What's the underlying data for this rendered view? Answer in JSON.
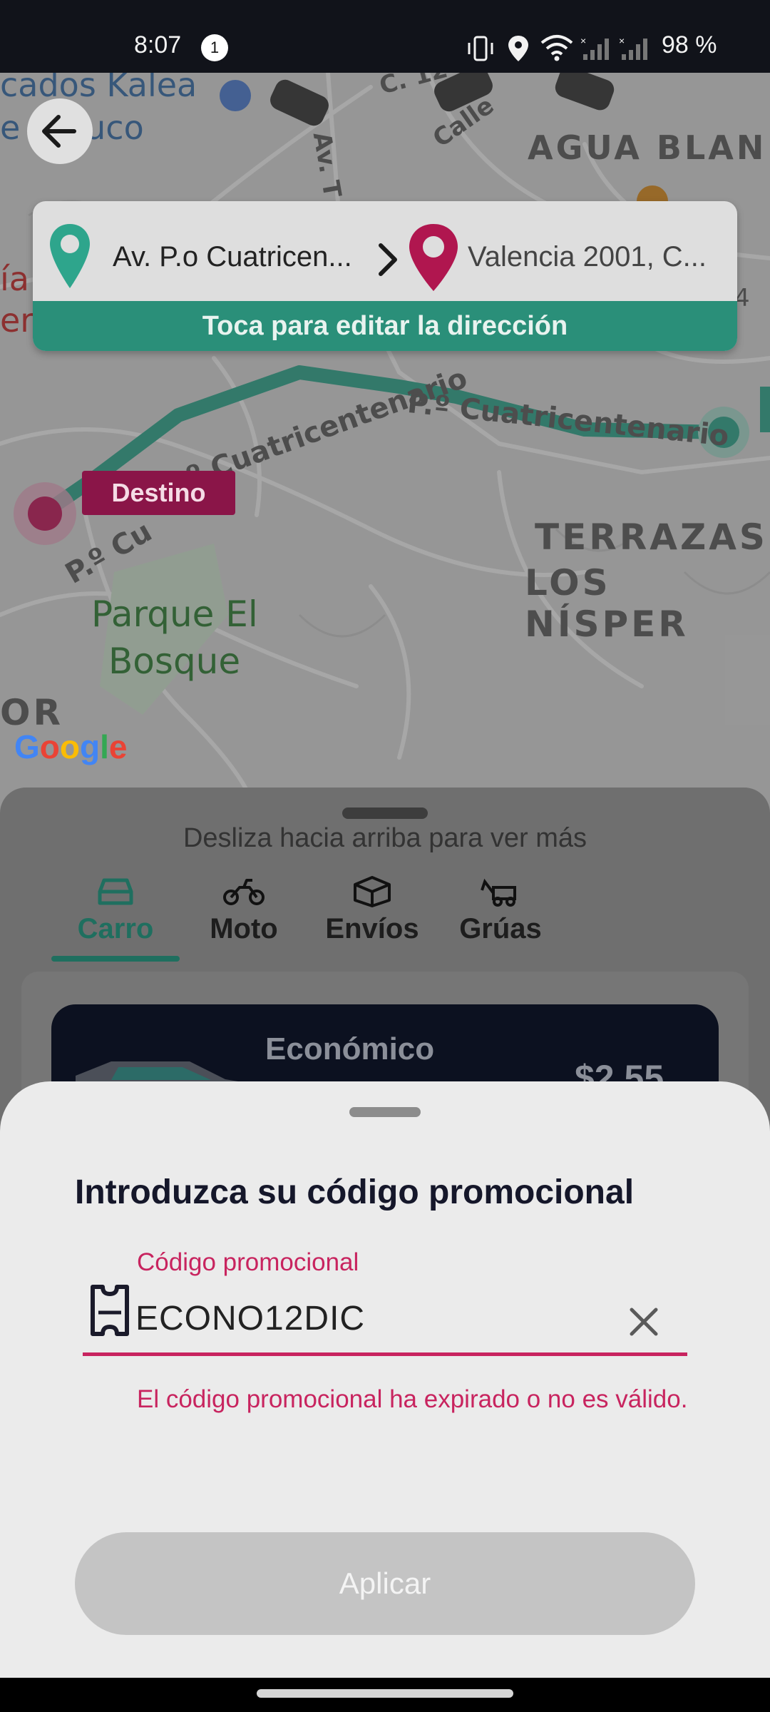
{
  "status_bar": {
    "time": "8:07",
    "notification_count": "1",
    "battery": "98 %"
  },
  "map": {
    "labels": {
      "market": "cados Kalea",
      "moruco": "e noruco",
      "agua_blanca": "AGUA BLAN",
      "terrazas": "TERRAZAS",
      "los_nisperos": "LOS NÍSPER",
      "parque": "Parque El",
      "parque_2": "Bosque",
      "street_1": "P.º Cuatricentenario",
      "street_2": "P.º Cuatricentenario",
      "street_3": "P.º Cu",
      "av": "Av. T",
      "calle": "Calle",
      "c12": "C. 12",
      "or": "OR",
      "left_1": "ía",
      "left_2": "er",
      "right_4": "4"
    },
    "destino_tag": "Destino",
    "google": [
      "G",
      "o",
      "o",
      "g",
      "l",
      "e"
    ],
    "google_colors": [
      "#4285F4",
      "#EA4335",
      "#FBBC05",
      "#4285F4",
      "#34A853",
      "#EA4335"
    ],
    "route_color": "#2ea58c",
    "destination_color": "#c2185b"
  },
  "route_card": {
    "origin": "Av. P.o Cuatricen...",
    "destination": "Valencia 2001, C...",
    "edit_label": "Toca para editar la dirección"
  },
  "panel": {
    "swipe_hint": "Desliza hacia arriba para ver más",
    "tabs": [
      {
        "label": "Carro",
        "icon": "car-icon",
        "active": true
      },
      {
        "label": "Moto",
        "icon": "motorcycle-icon",
        "active": false
      },
      {
        "label": "Envíos",
        "icon": "package-icon",
        "active": false
      },
      {
        "label": "Grúas",
        "icon": "tow-truck-icon",
        "active": false
      }
    ],
    "vehicle": {
      "name": "Económico",
      "price": "$2.55"
    }
  },
  "promo_sheet": {
    "title": "Introduzca su código promocional",
    "field_label": "Código promocional",
    "field_value": "ECONO12DIC",
    "error": "El código promocional ha expirado o no es válido.",
    "apply_label": "Aplicar",
    "accent_color": "#c8245f"
  }
}
